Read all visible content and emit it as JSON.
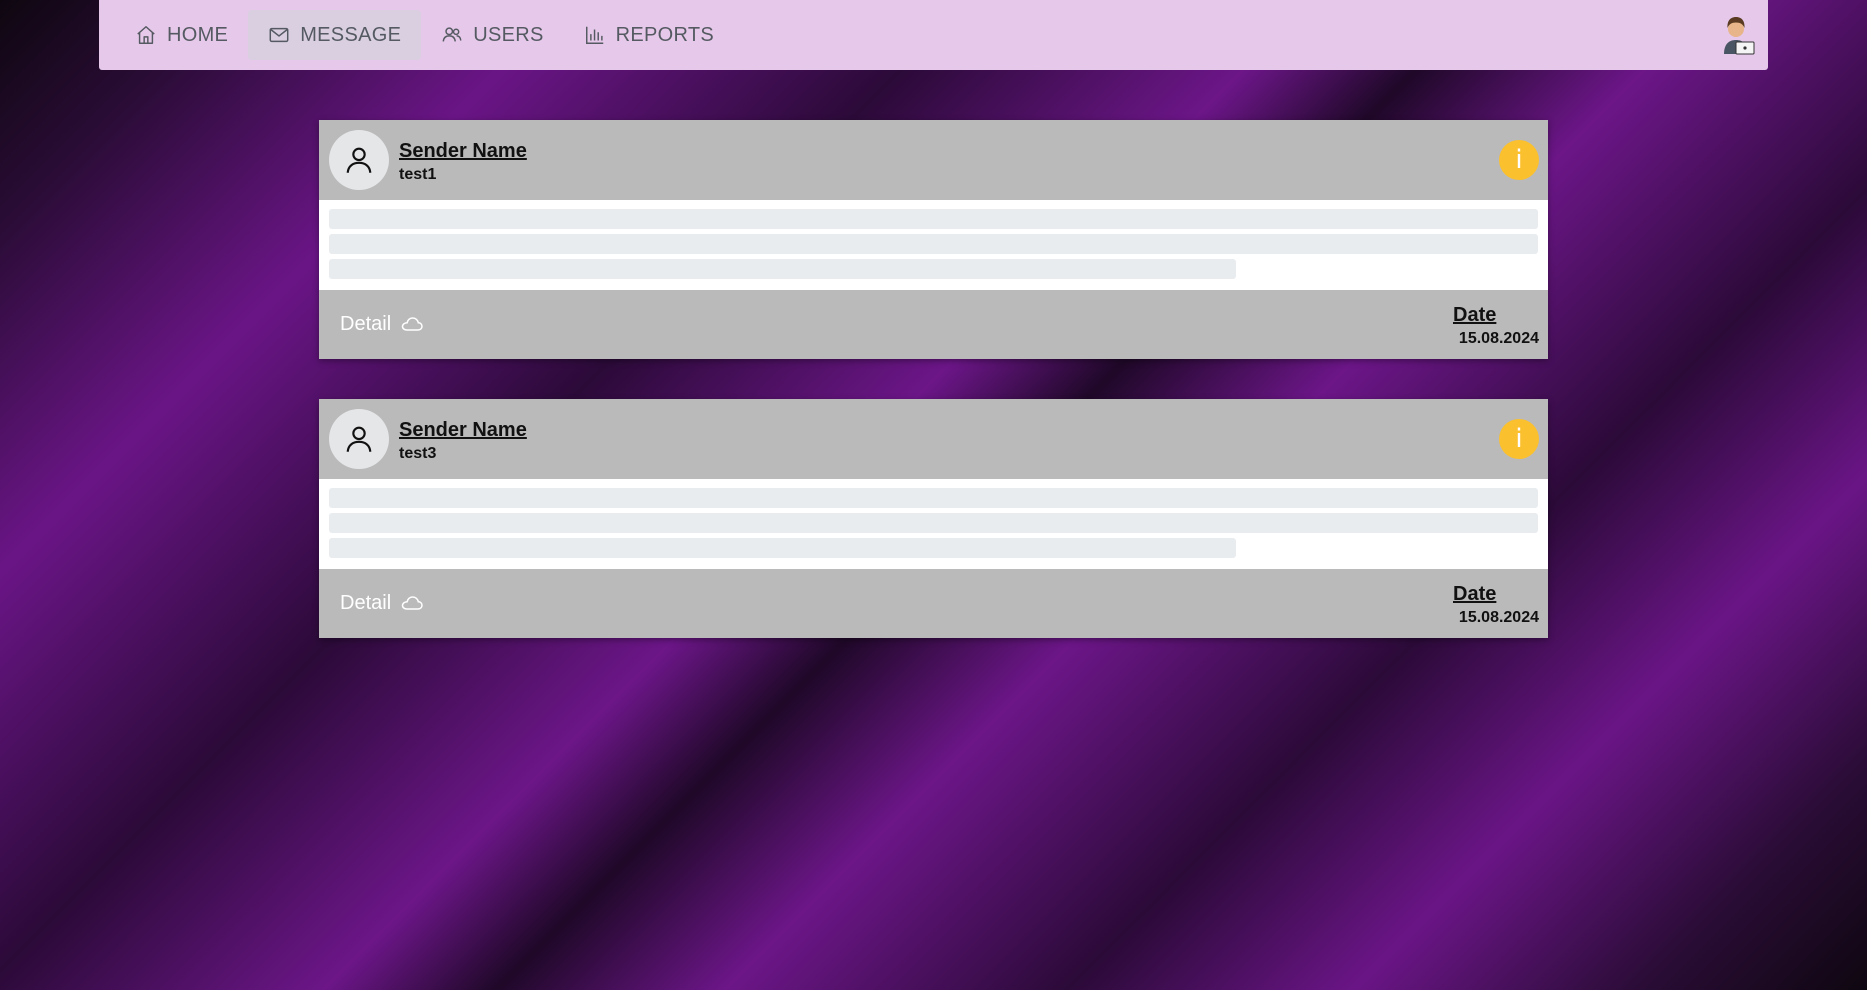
{
  "nav": {
    "items": [
      {
        "label": "HOME",
        "icon": "home-icon"
      },
      {
        "label": "MESSAGE",
        "icon": "mail-icon",
        "active": true
      },
      {
        "label": "USERS",
        "icon": "users-icon"
      },
      {
        "label": "REPORTS",
        "icon": "bar-chart-icon"
      }
    ],
    "profile_icon": "user-profile-avatar-icon"
  },
  "messages": [
    {
      "sender_label": "Sender Name",
      "sender": "test1",
      "badge": "i",
      "detail_label": "Detail",
      "date_label": "Date",
      "date": "15.08.2024"
    },
    {
      "sender_label": "Sender Name",
      "sender": "test3",
      "badge": "i",
      "detail_label": "Detail",
      "date_label": "Date",
      "date": "15.08.2024"
    }
  ],
  "colors": {
    "navbar": "#e6c9ea",
    "card_header": "#bababa",
    "badge": "#fbc02d",
    "skeleton": "#e9ecef"
  }
}
